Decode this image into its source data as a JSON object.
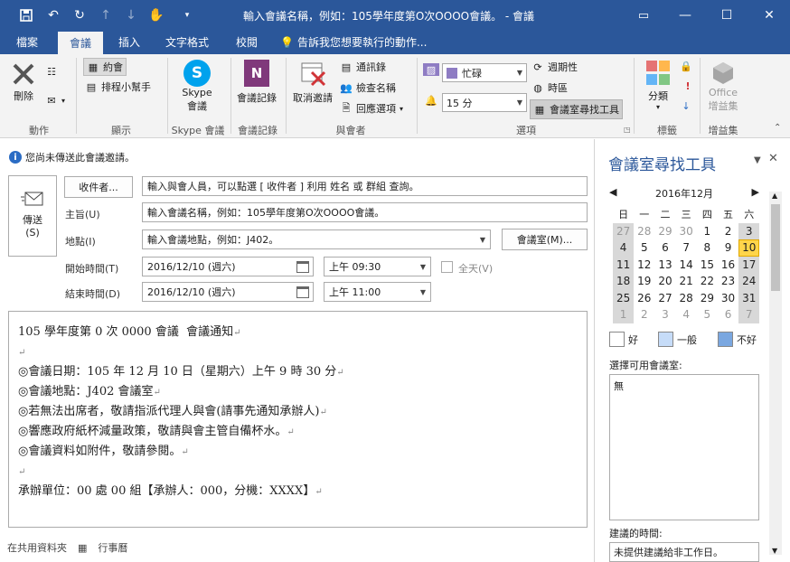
{
  "window": {
    "title": "輸入會議名稱，例如：105學年度第O次OOOO會議。 - 會議",
    "controls": {
      "restore": "▭",
      "minimize": "—",
      "maximize": "☐",
      "close": "✕"
    }
  },
  "quick_access": [
    "save-icon",
    "undo-icon",
    "redo-icon",
    "up-icon",
    "down-icon",
    "touch-icon",
    "customize-icon"
  ],
  "menu": {
    "items": [
      {
        "label": "檔案"
      },
      {
        "label": "會議"
      },
      {
        "label": "插入"
      },
      {
        "label": "文字格式"
      },
      {
        "label": "校閱"
      }
    ],
    "tell_me": "告訴我您想要執行的動作..."
  },
  "ribbon": {
    "delete_label": "刪除",
    "action_group": "動作",
    "appointment_label": "約會",
    "scheduling_label": "排程小幫手",
    "show_group": "顯示",
    "skype_label1": "Skype",
    "skype_label2": "會議",
    "skype_group": "Skype 會議",
    "notes_label": "會議記錄",
    "notes_group": "會議記錄",
    "cancel_label": "取消邀請",
    "address_book": "通訊錄",
    "check_names": "檢查名稱",
    "response_options": "回應選項",
    "attendees_group": "與會者",
    "busy_value": "忙碌",
    "reminder_value": "15 分",
    "recurrence": "週期性",
    "time_zones": "時區",
    "room_finder": "會議室尋找工具",
    "options_group": "選項",
    "categorize": "分類",
    "tags_group": "標籤",
    "office_addins1": "Office",
    "office_addins2": "增益集",
    "addins_group": "增益集"
  },
  "form": {
    "info": "您尚未傳送此會議邀請。",
    "send_label1": "傳送",
    "send_label2": "(S)",
    "to_button": "收件者...",
    "to_value": "輸入與會人員，可以點選 [ 收件者 ] 利用 姓名 或 群組 查詢。",
    "subject_label": "主旨(U)",
    "subject_value": "輸入會議名稱，例如：105學年度第O次OOOO會議。",
    "location_label": "地點(I)",
    "location_value": "輸入會議地點，例如：J402。",
    "room_button": "會議室(M)...",
    "start_label": "開始時間(T)",
    "start_date": "2016/12/10 (週六)",
    "start_time": "上午 09:30",
    "allday_label": "全天(V)",
    "end_label": "結束時間(D)",
    "end_date": "2016/12/10 (週六)",
    "end_time": "上午 11:00"
  },
  "body_lines": [
    "105 學年度第 0 次 0000 會議  會議通知",
    "",
    "◎會議日期：105 年 12 月 10 日（星期六）上午 9 時 30 分",
    "◎會議地點：J402 會議室",
    "◎若無法出席者，敬請指派代理人與會(請事先通知承辦人)",
    "◎響應政府紙杯減量政策，敬請與會主管自備杯水。",
    "◎會議資料如附件，敬請參閱。",
    "",
    "承辦單位：00 處 00 組【承辦人：000，分機：XXXX】"
  ],
  "status_bar": {
    "shared_folder": "在共用資料夾",
    "calendar": "行事曆"
  },
  "room_finder": {
    "title": "會議室尋找工具",
    "month": "2016年12月",
    "weekdays": [
      "日",
      "一",
      "二",
      "三",
      "四",
      "五",
      "六"
    ],
    "weeks": [
      [
        "27",
        "28",
        "29",
        "30",
        "1",
        "2",
        "3"
      ],
      [
        "4",
        "5",
        "6",
        "7",
        "8",
        "9",
        "10"
      ],
      [
        "11",
        "12",
        "13",
        "14",
        "15",
        "16",
        "17"
      ],
      [
        "18",
        "19",
        "20",
        "21",
        "22",
        "23",
        "24"
      ],
      [
        "25",
        "26",
        "27",
        "28",
        "29",
        "30",
        "31"
      ],
      [
        "1",
        "2",
        "3",
        "4",
        "5",
        "6",
        "7"
      ]
    ],
    "selected_day": "10",
    "legend": {
      "good": "好",
      "fair": "一般",
      "poor": "不好"
    },
    "legend_colors": {
      "good": "#ffffff",
      "fair": "#c6dcf8",
      "poor": "#7aa7e0"
    },
    "rooms_label": "選擇可用會議室:",
    "rooms_value": "無",
    "suggested_label": "建議的時間:",
    "suggested_value": "未提供建議給非工作日。"
  },
  "colors": {
    "brand": "#2b579a",
    "busy_swatch": "#8e7cc3",
    "selected_day": "#ffd54a"
  }
}
